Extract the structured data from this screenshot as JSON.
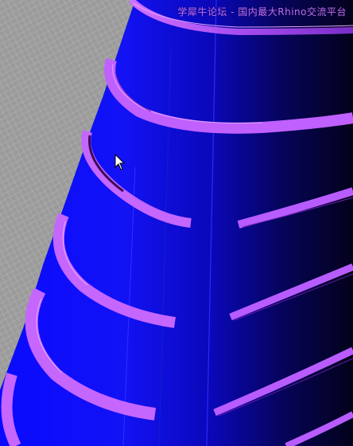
{
  "viewport": {
    "watermark": "学犀牛论坛 - 国内最大Rhino交流平台",
    "colors": {
      "background_grid": "#9a9a9a",
      "grid_line": "#b3b3b3",
      "surface_blue": "#1010ff",
      "surface_dark": "#06041a",
      "edge_magenta": "#b85cff",
      "edge_dark": "#3a0a55"
    },
    "icons": {
      "cursor": "arrow-cursor-icon"
    }
  }
}
